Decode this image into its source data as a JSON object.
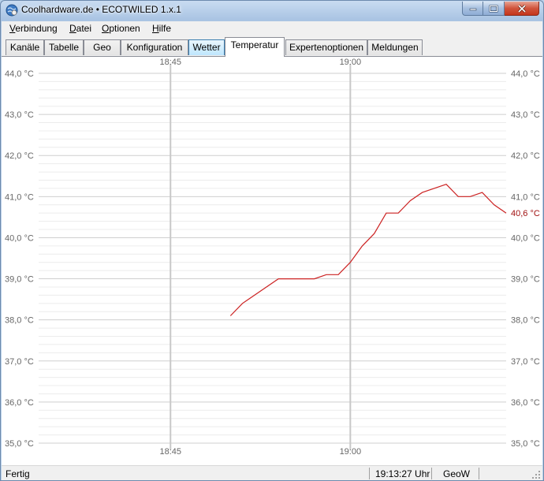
{
  "window": {
    "title": "Coolhardware.de • ECOTWILED 1.x.1",
    "icon": "app-globe-icon",
    "controls": [
      "minimize-icon",
      "maximize-icon",
      "close-icon"
    ]
  },
  "menu": [
    {
      "label": "Verbindung",
      "accel": "V",
      "rest": "erbindung"
    },
    {
      "label": "Datei",
      "accel": "D",
      "rest": "atei"
    },
    {
      "label": "Optionen",
      "accel": "O",
      "rest": "ptionen"
    },
    {
      "label": "Hilfe",
      "accel": "H",
      "rest": "ilfe"
    }
  ],
  "tabs": [
    {
      "label": "Kanäle"
    },
    {
      "label": "Tabelle"
    },
    {
      "label": "Geo"
    },
    {
      "label": "Konfiguration"
    },
    {
      "label": "Wetter",
      "state": "hover"
    },
    {
      "label": "Temperatur",
      "state": "active"
    },
    {
      "label": "Expertenoptionen"
    },
    {
      "label": "Meldungen"
    }
  ],
  "chart_data": {
    "type": "line",
    "title": "",
    "xlabel": "",
    "ylabel": "",
    "y_tick_labels": [
      "44,0 °C",
      "43,0 °C",
      "42,0 °C",
      "41,0 °C",
      "40,0 °C",
      "39,0 °C",
      "38,0 °C",
      "37,0 °C",
      "36,0 °C",
      "35,0 °C"
    ],
    "x_tick_labels": [
      "18:45",
      "19:00"
    ],
    "ylim": [
      35.0,
      44.0
    ],
    "xlim": [
      "18:34",
      "19:13"
    ],
    "minor_grid_step": 0.2,
    "grid": true,
    "x_axis_positions": [
      "top",
      "bottom"
    ],
    "y_axis_positions": [
      "left",
      "right"
    ],
    "current_value_label": "40,6 °C",
    "line_color": "#cc2222",
    "series": [
      {
        "values": [
          {
            "x": "18:50",
            "y": 38.1
          },
          {
            "x": "18:51",
            "y": 38.4
          },
          {
            "x": "18:54",
            "y": 39.0
          },
          {
            "x": "18:57",
            "y": 39.0
          },
          {
            "x": "18:58",
            "y": 39.1
          },
          {
            "x": "18:59",
            "y": 39.1
          },
          {
            "x": "19:00",
            "y": 39.4
          },
          {
            "x": "19:01",
            "y": 39.8
          },
          {
            "x": "19:02",
            "y": 40.1
          },
          {
            "x": "19:03",
            "y": 40.6
          },
          {
            "x": "19:04",
            "y": 40.6
          },
          {
            "x": "19:05",
            "y": 40.9
          },
          {
            "x": "19:06",
            "y": 41.1
          },
          {
            "x": "19:08",
            "y": 41.3
          },
          {
            "x": "19:09",
            "y": 41.0
          },
          {
            "x": "19:10",
            "y": 41.0
          },
          {
            "x": "19:11",
            "y": 41.1
          },
          {
            "x": "19:12",
            "y": 40.8
          },
          {
            "x": "19:13",
            "y": 40.6
          }
        ]
      }
    ]
  },
  "status": {
    "state": "Fertig",
    "time": "19:13:27 Uhr",
    "mode": "GeoW"
  }
}
